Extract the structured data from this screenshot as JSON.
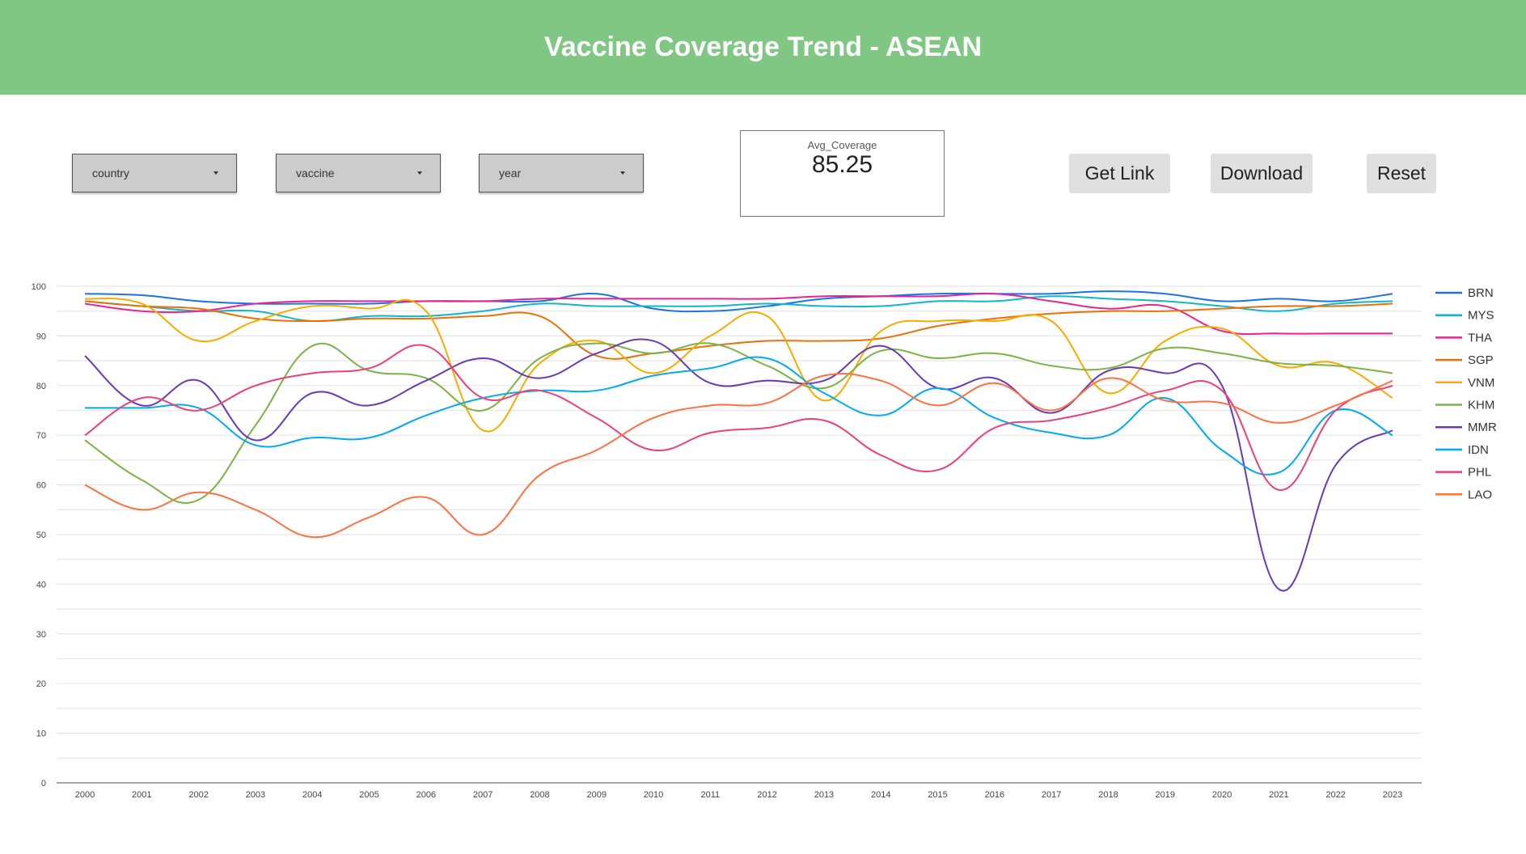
{
  "header": {
    "title": "Vaccine Coverage Trend - ASEAN"
  },
  "filters": [
    {
      "label": "country"
    },
    {
      "label": "vaccine"
    },
    {
      "label": "year"
    }
  ],
  "scorecard": {
    "label": "Avg_Coverage",
    "value": "85.25"
  },
  "buttons": {
    "get_link": "Get Link",
    "download": "Download",
    "reset": "Reset"
  },
  "chart_data": {
    "type": "line",
    "title": "",
    "xlabel": "",
    "ylabel": "",
    "ylim": [
      0,
      100
    ],
    "yticks": [
      0,
      10,
      20,
      30,
      40,
      50,
      60,
      70,
      80,
      90,
      100
    ],
    "grid": true,
    "legend": "right",
    "smooth": true,
    "x": [
      "2000",
      "2001",
      "2002",
      "2003",
      "2004",
      "2005",
      "2006",
      "2007",
      "2008",
      "2009",
      "2010",
      "2011",
      "2012",
      "2013",
      "2014",
      "2015",
      "2016",
      "2017",
      "2018",
      "2019",
      "2020",
      "2021",
      "2022",
      "2023"
    ],
    "series": [
      {
        "name": "BRN",
        "color": "#1a73e8",
        "values": [
          98.5,
          98.2,
          97,
          96.5,
          96.5,
          96.5,
          97,
          97,
          97,
          98.5,
          95.5,
          95,
          96,
          97.5,
          98,
          98.5,
          98.5,
          98.5,
          99,
          98.5,
          97,
          97.5,
          97,
          98.5
        ]
      },
      {
        "name": "MYS",
        "color": "#12b5cb",
        "values": [
          97,
          96,
          95,
          95,
          93,
          94,
          94,
          95,
          96.5,
          96,
          96,
          96,
          96.5,
          96,
          96,
          97,
          97,
          98,
          97.5,
          97,
          96,
          95,
          96.5,
          97
        ]
      },
      {
        "name": "THA",
        "color": "#e52592",
        "values": [
          96.5,
          95,
          95,
          96.5,
          97,
          97,
          97,
          97,
          97.5,
          97.5,
          97.5,
          97.5,
          97.5,
          98,
          98,
          98,
          98.5,
          97,
          95.5,
          96,
          91,
          90.5,
          90.5,
          90.5
        ]
      },
      {
        "name": "SGP",
        "color": "#e8710a",
        "values": [
          97,
          96,
          95.5,
          93.5,
          93,
          93.5,
          93.5,
          94,
          94,
          86,
          86.5,
          88,
          89,
          89,
          89.5,
          92,
          93.5,
          94.5,
          95,
          95,
          95.5,
          96,
          96,
          96.5
        ]
      },
      {
        "name": "VNM",
        "color": "#f9ab00",
        "values": [
          97.5,
          96.5,
          89,
          93,
          96,
          95.5,
          95,
          71,
          84.5,
          89,
          82.5,
          90,
          94,
          77,
          91,
          93,
          93,
          93,
          78.5,
          89,
          91.5,
          84,
          84.5,
          77.5
        ]
      },
      {
        "name": "KHM",
        "color": "#7cb342",
        "values": [
          69,
          61,
          57,
          72,
          88,
          83,
          81.5,
          75,
          85.5,
          88.5,
          86.5,
          88.5,
          84,
          79.5,
          87,
          85.5,
          86.5,
          84,
          83.5,
          87.5,
          86.5,
          84.5,
          84,
          82.5
        ]
      },
      {
        "name": "MMR",
        "color": "#673ab7",
        "values": [
          86,
          76,
          81,
          69,
          78.5,
          76,
          81,
          85.5,
          81.5,
          86.5,
          89,
          80.5,
          81,
          81,
          88,
          79.5,
          81.5,
          74.5,
          83,
          82.5,
          80,
          39,
          64,
          71
        ]
      },
      {
        "name": "IDN",
        "color": "#03a9f4",
        "values": [
          75.5,
          75.5,
          75.5,
          68,
          69.5,
          69.5,
          74,
          77.5,
          79,
          79,
          82,
          83.5,
          85.5,
          78.5,
          74,
          79.5,
          73.5,
          70.5,
          70,
          77.5,
          67,
          62.5,
          75,
          70
        ]
      },
      {
        "name": "PHL",
        "color": "#ec407a",
        "values": [
          70,
          77.5,
          75,
          80,
          82.5,
          83.5,
          88,
          77.5,
          79,
          73.5,
          67,
          70.5,
          71.5,
          73,
          66,
          63,
          71.5,
          73,
          75.5,
          79,
          79,
          59,
          75,
          80
        ]
      },
      {
        "name": "LAO",
        "color": "#ff7043",
        "values": [
          60,
          55,
          58.5,
          55,
          49.5,
          53.5,
          57.5,
          50,
          62,
          67,
          73.5,
          76,
          76.5,
          82,
          81,
          76,
          80.5,
          75,
          81.5,
          77,
          76.5,
          72.5,
          76,
          81
        ]
      }
    ]
  }
}
